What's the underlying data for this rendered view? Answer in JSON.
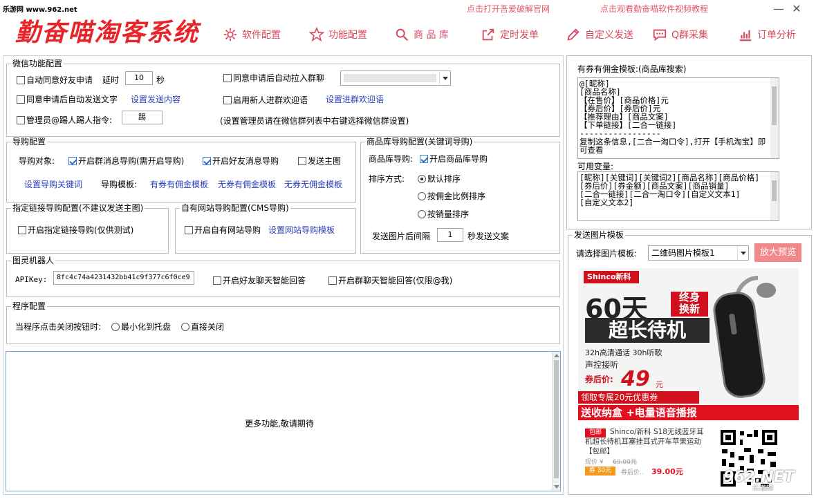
{
  "watermark": "乐游网 www.962.net",
  "logo": "勤奋喵淘客系统",
  "top_links": {
    "crack": "点击打开吾爱破解官网",
    "video": "点击观看勤奋喵软件视频教程"
  },
  "window": {
    "minimize": "—",
    "close": "✕"
  },
  "nav": [
    {
      "label": "软件配置",
      "icon": "gear-icon"
    },
    {
      "label": "功能配置",
      "icon": "star-icon"
    },
    {
      "label": "商 品 库",
      "icon": "search-icon"
    },
    {
      "label": "定时发单",
      "icon": "share-icon"
    },
    {
      "label": "自定义发送",
      "icon": "pencil-icon"
    },
    {
      "label": "Q群采集",
      "icon": "chat-icon"
    },
    {
      "label": "订单分析",
      "icon": "bar-chart-icon"
    }
  ],
  "wechat": {
    "title": "微信功能配置",
    "auto_accept": "自动同意好友申请",
    "delay_label": "延时",
    "delay_value": "10",
    "delay_unit": "秒",
    "auto_pull": "同意申请后自动拉入群聊",
    "auto_send_text": "同意申请后自动发送文字",
    "set_send_content": "设置发送内容",
    "welcome": "启用新人进群欢迎语",
    "set_welcome": "设置进群欢迎语",
    "admin_kick": "管理员@踢人",
    "kick_cmd_label": "踢人指令:",
    "kick_cmd_value": "踢",
    "admin_hint": "(设置管理员请在微信群列表中右键选择微信群设置)"
  },
  "guide": {
    "title": "导购配置",
    "target_label": "导购对象:",
    "group_guide": "开启群消息导购(需开启导购)",
    "friend_guide": "开启好友消息导购",
    "send_main_img": "发送主图",
    "set_keywords": "设置导购关键词",
    "template_label": "导购模板:",
    "tpl1": "有券有佣金模板",
    "tpl2": "无券有佣金模板",
    "tpl3": "无券无佣金模板"
  },
  "link_guide": {
    "title": "指定链接导购配置(不建议发送主图)",
    "enable": "开启指定链接导购(仅供测试)"
  },
  "site_guide": {
    "title": "自有网站导购配置(CMS导购)",
    "enable": "开启自有网站导购",
    "set_tpl": "设置网站导购模板"
  },
  "product_guide": {
    "title": "商品库导购配置(关键词导购)",
    "label": "商品库导购:",
    "enable": "开启商品库导购",
    "sort_label": "排序方式:",
    "sort_default": "默认排序",
    "sort_commission": "按佣金比例排序",
    "sort_sales": "按销量排序",
    "interval_label": "发送图片后间隔",
    "interval_value": "1",
    "interval_suffix": "秒发送文案"
  },
  "robot": {
    "title": "图灵机器人",
    "apikey_label": "APIKey:",
    "apikey_value": "8fc4c74a4231432bb41c9f377c6f0ce9",
    "friend_reply": "开启好友聊天智能回答",
    "group_reply": "开启群聊天智能回答(仅限@我)"
  },
  "program": {
    "title": "程序配置",
    "close_label": "当程序点击关闭按钮时:",
    "minimize": "最小化到托盘",
    "direct_close": "直接关闭"
  },
  "log_area": {
    "text": "更多功能,敬请期待"
  },
  "template_box": {
    "title": "有券有佣金模板:(商品库搜索)",
    "content": "@[昵称]\n[商品名称]\n【在售价】[商品价格]元\n【券后价】[券后价]元\n【推荐理由】[商品文案]\n【下单链接】[二合一链接]\n-----------------\n复制这条信息,[二合一淘口令],打开【手机淘宝】即可查看",
    "vars_label": "可用变量:",
    "vars": "[昵称][关键词][关键词2][商品名称][商品价格]\n[券后价][券金额][商品文案][商品销量]\n[二合一链接][二合一淘口令][自定义文本1]\n[自定义文本2]"
  },
  "image_template": {
    "title": "发送图片模板",
    "select_label": "请选择图片模板:",
    "selected": "二维码图片模板1",
    "preview_button": "放大预览"
  },
  "ad": {
    "brand": "Shinco新科",
    "days": "60天",
    "tag1": "终身",
    "tag2": "换新",
    "standby": "超长待机",
    "feat1": "32h高清通话 30h听歌",
    "feat2": "声控接听",
    "price_label": "券后价:",
    "price": "49",
    "price_unit": "元",
    "coupon": "领取专属20元优惠券",
    "gift": "送收纳盒 +电量语音播报",
    "pkg": "包邮",
    "desc": "Shinco/新科 S18无线蓝牙耳机超长待机耳塞挂耳式开车苹果运动【包邮】",
    "now_label": "现价 ¥",
    "now_price": "69.00元",
    "coupon_badge": "券 30元",
    "after_label": "券后价..",
    "after_price": "39.00元",
    "site_wm": "962.NET",
    "site_wm2": "乐游网"
  },
  "colors": {
    "accent": "#e8232a",
    "nav": "#d9495e",
    "link": "#2a3fb8",
    "preview_btn": "#f08a8a"
  }
}
